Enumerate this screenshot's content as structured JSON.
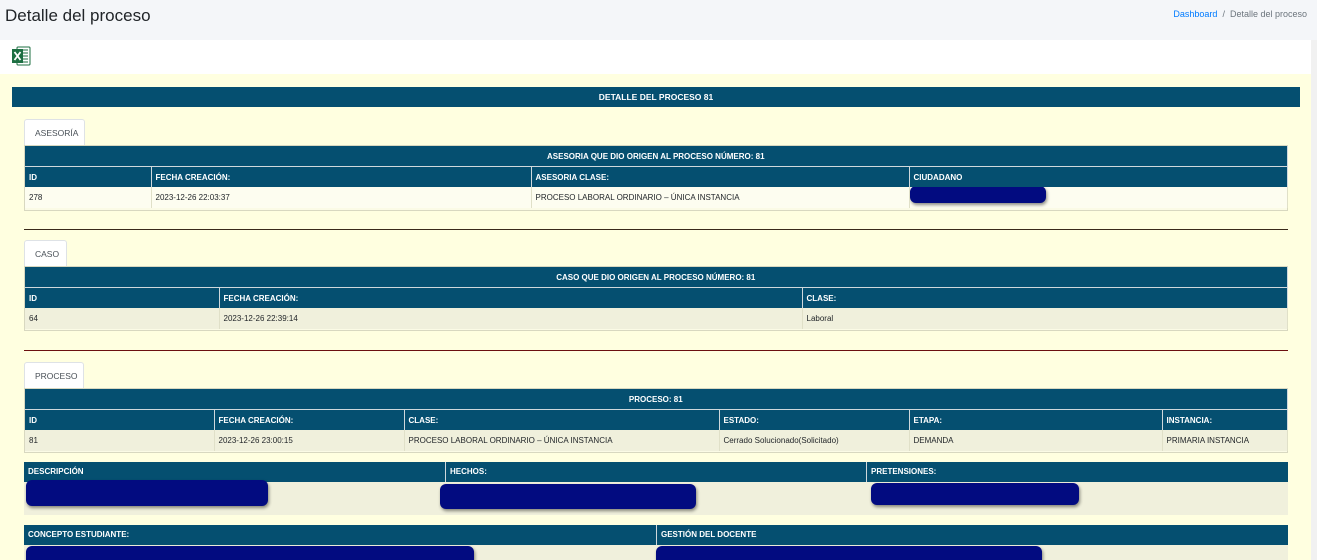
{
  "page": {
    "title": "Detalle del proceso",
    "breadcrumb": {
      "home": "Dashboard",
      "separator": "/",
      "current": "Detalle del proceso"
    }
  },
  "toolbar": {
    "export_icon": "excel-icon"
  },
  "main_header": "DETALLE DEL PROCESO 81",
  "asesoria": {
    "tab_label": "ASESORÍA",
    "caption": "ASESORIA QUE DIO ORIGEN AL PROCESO NÚMERO: 81",
    "columns": [
      "ID",
      "FECHA CREACIÓN:",
      "ASESORIA CLASE:",
      "CIUDADANO"
    ],
    "row": {
      "id": "278",
      "fecha": "2023-12-26 22:03:37",
      "clase": "PROCESO LABORAL ORDINARIO – ÚNICA INSTANCIA"
    }
  },
  "caso": {
    "tab_label": "CASO",
    "caption": "CASO QUE DIO ORIGEN AL PROCESO NÚMERO: 81",
    "columns": [
      "ID",
      "FECHA CREACIÓN:",
      "CLASE:"
    ],
    "row": {
      "id": "64",
      "fecha": "2023-12-26 22:39:14",
      "clase": "Laboral"
    }
  },
  "proceso": {
    "tab_label": "PROCESO",
    "caption": "PROCESO: 81",
    "columns": [
      "ID",
      "FECHA CREACIÓN:",
      "CLASE:",
      "ESTADO:",
      "ETAPA:",
      "INSTANCIA:"
    ],
    "row": {
      "id": "81",
      "fecha": "2023-12-26 23:00:15",
      "clase": "PROCESO LABORAL ORDINARIO – ÚNICA INSTANCIA",
      "estado": "Cerrado Solucionado(Solicitado)",
      "etapa": "DEMANDA",
      "instancia": "PRIMARIA INSTANCIA"
    },
    "details_headers": [
      "DESCRIPCIÓN",
      "HECHOS:",
      "PRETENSIONES:"
    ],
    "eval_headers": [
      "CONCEPTO ESTUDIANTE:",
      "GESTIÓN DEL DOCENTE"
    ]
  },
  "colors": {
    "header": "#054f70",
    "content_bg": "#ffffe0",
    "redaction": "#020b80",
    "divider_1": "#3a2a1a",
    "divider_2": "#6b0f0f"
  }
}
